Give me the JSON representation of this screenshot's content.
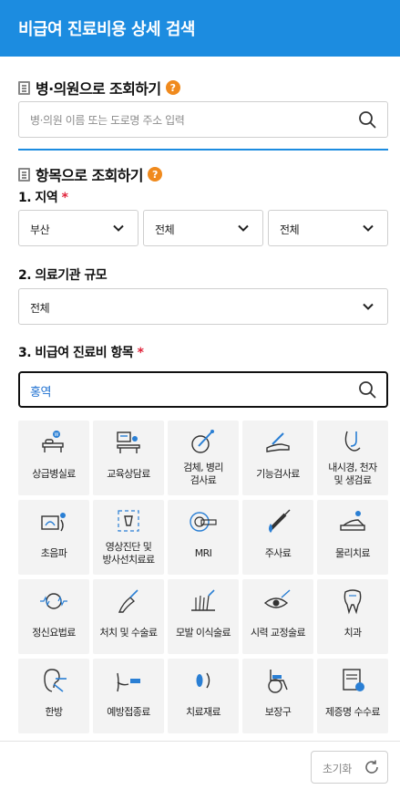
{
  "header": {
    "title": "비급여 진료비용 상세 검색"
  },
  "hospital_search": {
    "title": "병·의원으로 조회하기",
    "help": "?",
    "placeholder": "병·의원 이름 또는 도로명 주소 입력"
  },
  "item_search": {
    "title": "항목으로 조회하기",
    "help": "?",
    "region": {
      "label": "1. 지역",
      "required": "*",
      "selects": [
        "부산",
        "전체",
        "전체"
      ]
    },
    "scale": {
      "label": "2. 의료기관 규모",
      "value": "전체"
    },
    "item": {
      "label": "3. 비급여 진료비 항목",
      "required": "*",
      "keyword": "홍역"
    }
  },
  "categories": [
    {
      "label": "상급병실료",
      "icon": "hospital-bed-icon"
    },
    {
      "label": "교육상담료",
      "icon": "counseling-desk-icon"
    },
    {
      "label": "검체, 병리\n검사료",
      "icon": "specimen-test-icon"
    },
    {
      "label": "기능검사료",
      "icon": "arm-test-icon"
    },
    {
      "label": "내시경, 천자\n및 생검료",
      "icon": "endoscope-icon"
    },
    {
      "label": "초음파",
      "icon": "ultrasound-icon"
    },
    {
      "label": "영상진단 및\n방사선치료료",
      "icon": "xray-imaging-icon"
    },
    {
      "label": "MRI",
      "icon": "mri-machine-icon"
    },
    {
      "label": "주사료",
      "icon": "syringe-icon"
    },
    {
      "label": "물리치료",
      "icon": "physical-therapy-icon"
    },
    {
      "label": "정신요법료",
      "icon": "brain-wave-icon"
    },
    {
      "label": "처치 및 수술료",
      "icon": "scalpel-hand-icon"
    },
    {
      "label": "모발 이식술료",
      "icon": "hair-transplant-icon"
    },
    {
      "label": "시력 교정술료",
      "icon": "eye-laser-icon"
    },
    {
      "label": "치과",
      "icon": "tooth-icon"
    },
    {
      "label": "한방",
      "icon": "acupuncture-ear-icon"
    },
    {
      "label": "예방접종료",
      "icon": "vaccination-arm-icon"
    },
    {
      "label": "치료재료",
      "icon": "treatment-material-icon"
    },
    {
      "label": "보장구",
      "icon": "wheelchair-icon"
    },
    {
      "label": "제증명 수수료",
      "icon": "certificate-document-icon"
    }
  ],
  "footer": {
    "reset_label": "초기화"
  },
  "colors": {
    "brand": "#1c8ce0",
    "help": "#f08a1d",
    "required": "#e0233a",
    "tile_bg": "#f3f3f3",
    "icon_blue": "#2a7fd4"
  }
}
